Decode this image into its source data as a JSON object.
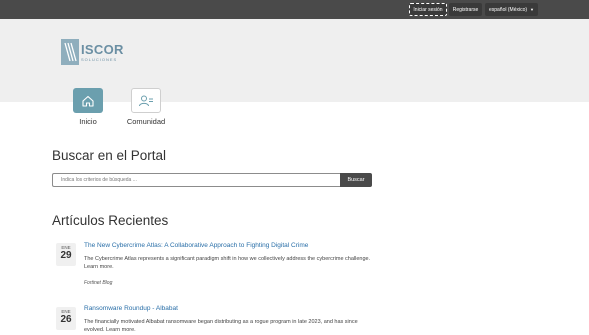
{
  "topbar": {
    "login_label": "Iniciar sesión",
    "register_label": "Registrarse",
    "language_label": "español (México)"
  },
  "logo": {
    "name": "ISCOR",
    "tagline": "SOLUCIONES"
  },
  "nav": {
    "tiles": [
      {
        "label": "Inicio",
        "icon": "home-icon"
      },
      {
        "label": "Comunidad",
        "icon": "community-icon"
      }
    ]
  },
  "search": {
    "heading": "Buscar en el Portal",
    "placeholder": "Indica los criterios de búsqueda ...",
    "button_label": "Buscar"
  },
  "articles": {
    "heading": "Artículos Recientes",
    "items": [
      {
        "month": "ENE",
        "day": "29",
        "title": "The New Cybercrime Atlas: A Collaborative Approach to Fighting Digital Crime",
        "description": "The Cybercrime Atlas represents a significant paradigm shift in how we collectively address the cybercrime challenge. Learn more.",
        "source": "Fortinet Blog"
      },
      {
        "month": "ENE",
        "day": "26",
        "title": "Ransomware Roundup - Albabat",
        "description": "The financially motivated Albabat ransomware began distributing as a rogue program in late 2023, and has since evolved. Learn more."
      }
    ]
  },
  "colors": {
    "topbar": "#4a4a4a",
    "hero": "#efefef",
    "accent": "#6b9fae",
    "link": "#2a6fa8"
  }
}
